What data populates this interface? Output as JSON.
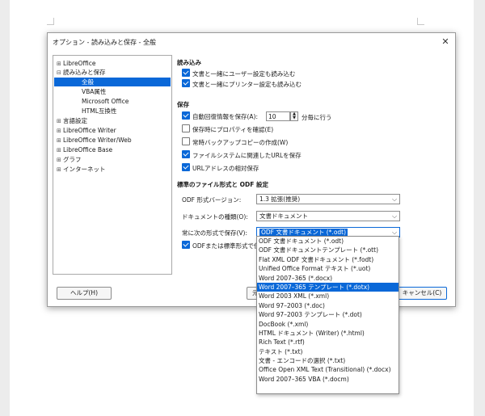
{
  "dialog": {
    "title": "オプション - 読み込みと保存 - 全般",
    "close_glyph": "✕"
  },
  "tree": {
    "expand_glyph": "⊞",
    "collapse_glyph": "⊟",
    "items": [
      {
        "label": "LibreOffice",
        "state": "collapsed"
      },
      {
        "label": "読み込みと保存",
        "state": "expanded"
      },
      {
        "label": "全般",
        "selected": true
      },
      {
        "label": "VBA属性"
      },
      {
        "label": "Microsoft Office"
      },
      {
        "label": "HTML互換性"
      },
      {
        "label": "言語設定",
        "state": "collapsed"
      },
      {
        "label": "LibreOffice Writer",
        "state": "collapsed"
      },
      {
        "label": "LibreOffice Writer/Web",
        "state": "collapsed"
      },
      {
        "label": "LibreOffice Base",
        "state": "collapsed"
      },
      {
        "label": "グラフ",
        "state": "collapsed"
      },
      {
        "label": "インターネット",
        "state": "collapsed"
      }
    ]
  },
  "load": {
    "heading": "読み込み",
    "user_settings": {
      "label": "文書と一緒にユーザー設定も読み込む",
      "checked": true
    },
    "printer_settings": {
      "label": "文書と一緒にプリンター設定も読み込む",
      "checked": true
    }
  },
  "save": {
    "heading": "保存",
    "autorecovery": {
      "label": "自動回復情報を保存(A):",
      "checked": true,
      "value": "10",
      "unit": "分毎に行う"
    },
    "confirm_props": {
      "label": "保存時にプロパティを確認(E)",
      "checked": false
    },
    "backup": {
      "label": "常時バックアップコピーの作成(W)",
      "checked": false
    },
    "relative_fs": {
      "label": "ファイルシステムに関連したURLを保存",
      "checked": true
    },
    "relative_internet": {
      "label": "URLアドレスの相対保存",
      "checked": true
    }
  },
  "default_format": {
    "heading": "標準のファイル形式と ODF 設定",
    "odf_version_label": "ODF 形式バージョン:",
    "odf_version_value": "1.3 拡張(推奨)",
    "doc_type_label": "ドキュメントの種類(O):",
    "doc_type_value": "文書ドキュメント",
    "always_save_label": "常に次の形式で保存(V):",
    "always_save_value": "ODF 文書ドキュメント (*.odt)",
    "warn_label": "ODFまたは標準形式で保"
  },
  "buttons": {
    "help": "ヘルプ(H)",
    "reset_partial": "元",
    "cancel": "キャンセル(C)"
  },
  "dropdown": {
    "highlighted_index": 5,
    "options": [
      "ODF 文書ドキュメント (*.odt)",
      "ODF 文書ドキュメントテンプレート (*.ott)",
      "Flat XML ODF 文書ドキュメント (*.fodt)",
      "Unified Office Format テキスト (*.uot)",
      "Word 2007–365 (*.docx)",
      "Word 2007–365 テンプレート (*.dotx)",
      "Word 2003 XML (*.xml)",
      "Word 97–2003 (*.doc)",
      "Word 97–2003 テンプレート (*.dot)",
      "DocBook (*.xml)",
      "HTML ドキュメント (Writer) (*.html)",
      "Rich Text (*.rtf)",
      "テキスト (*.txt)",
      "文書 - エンコードの選択 (*.txt)",
      "Office Open XML Text (Transitional) (*.docx)",
      "Word 2007–365 VBA (*.docm)"
    ]
  }
}
